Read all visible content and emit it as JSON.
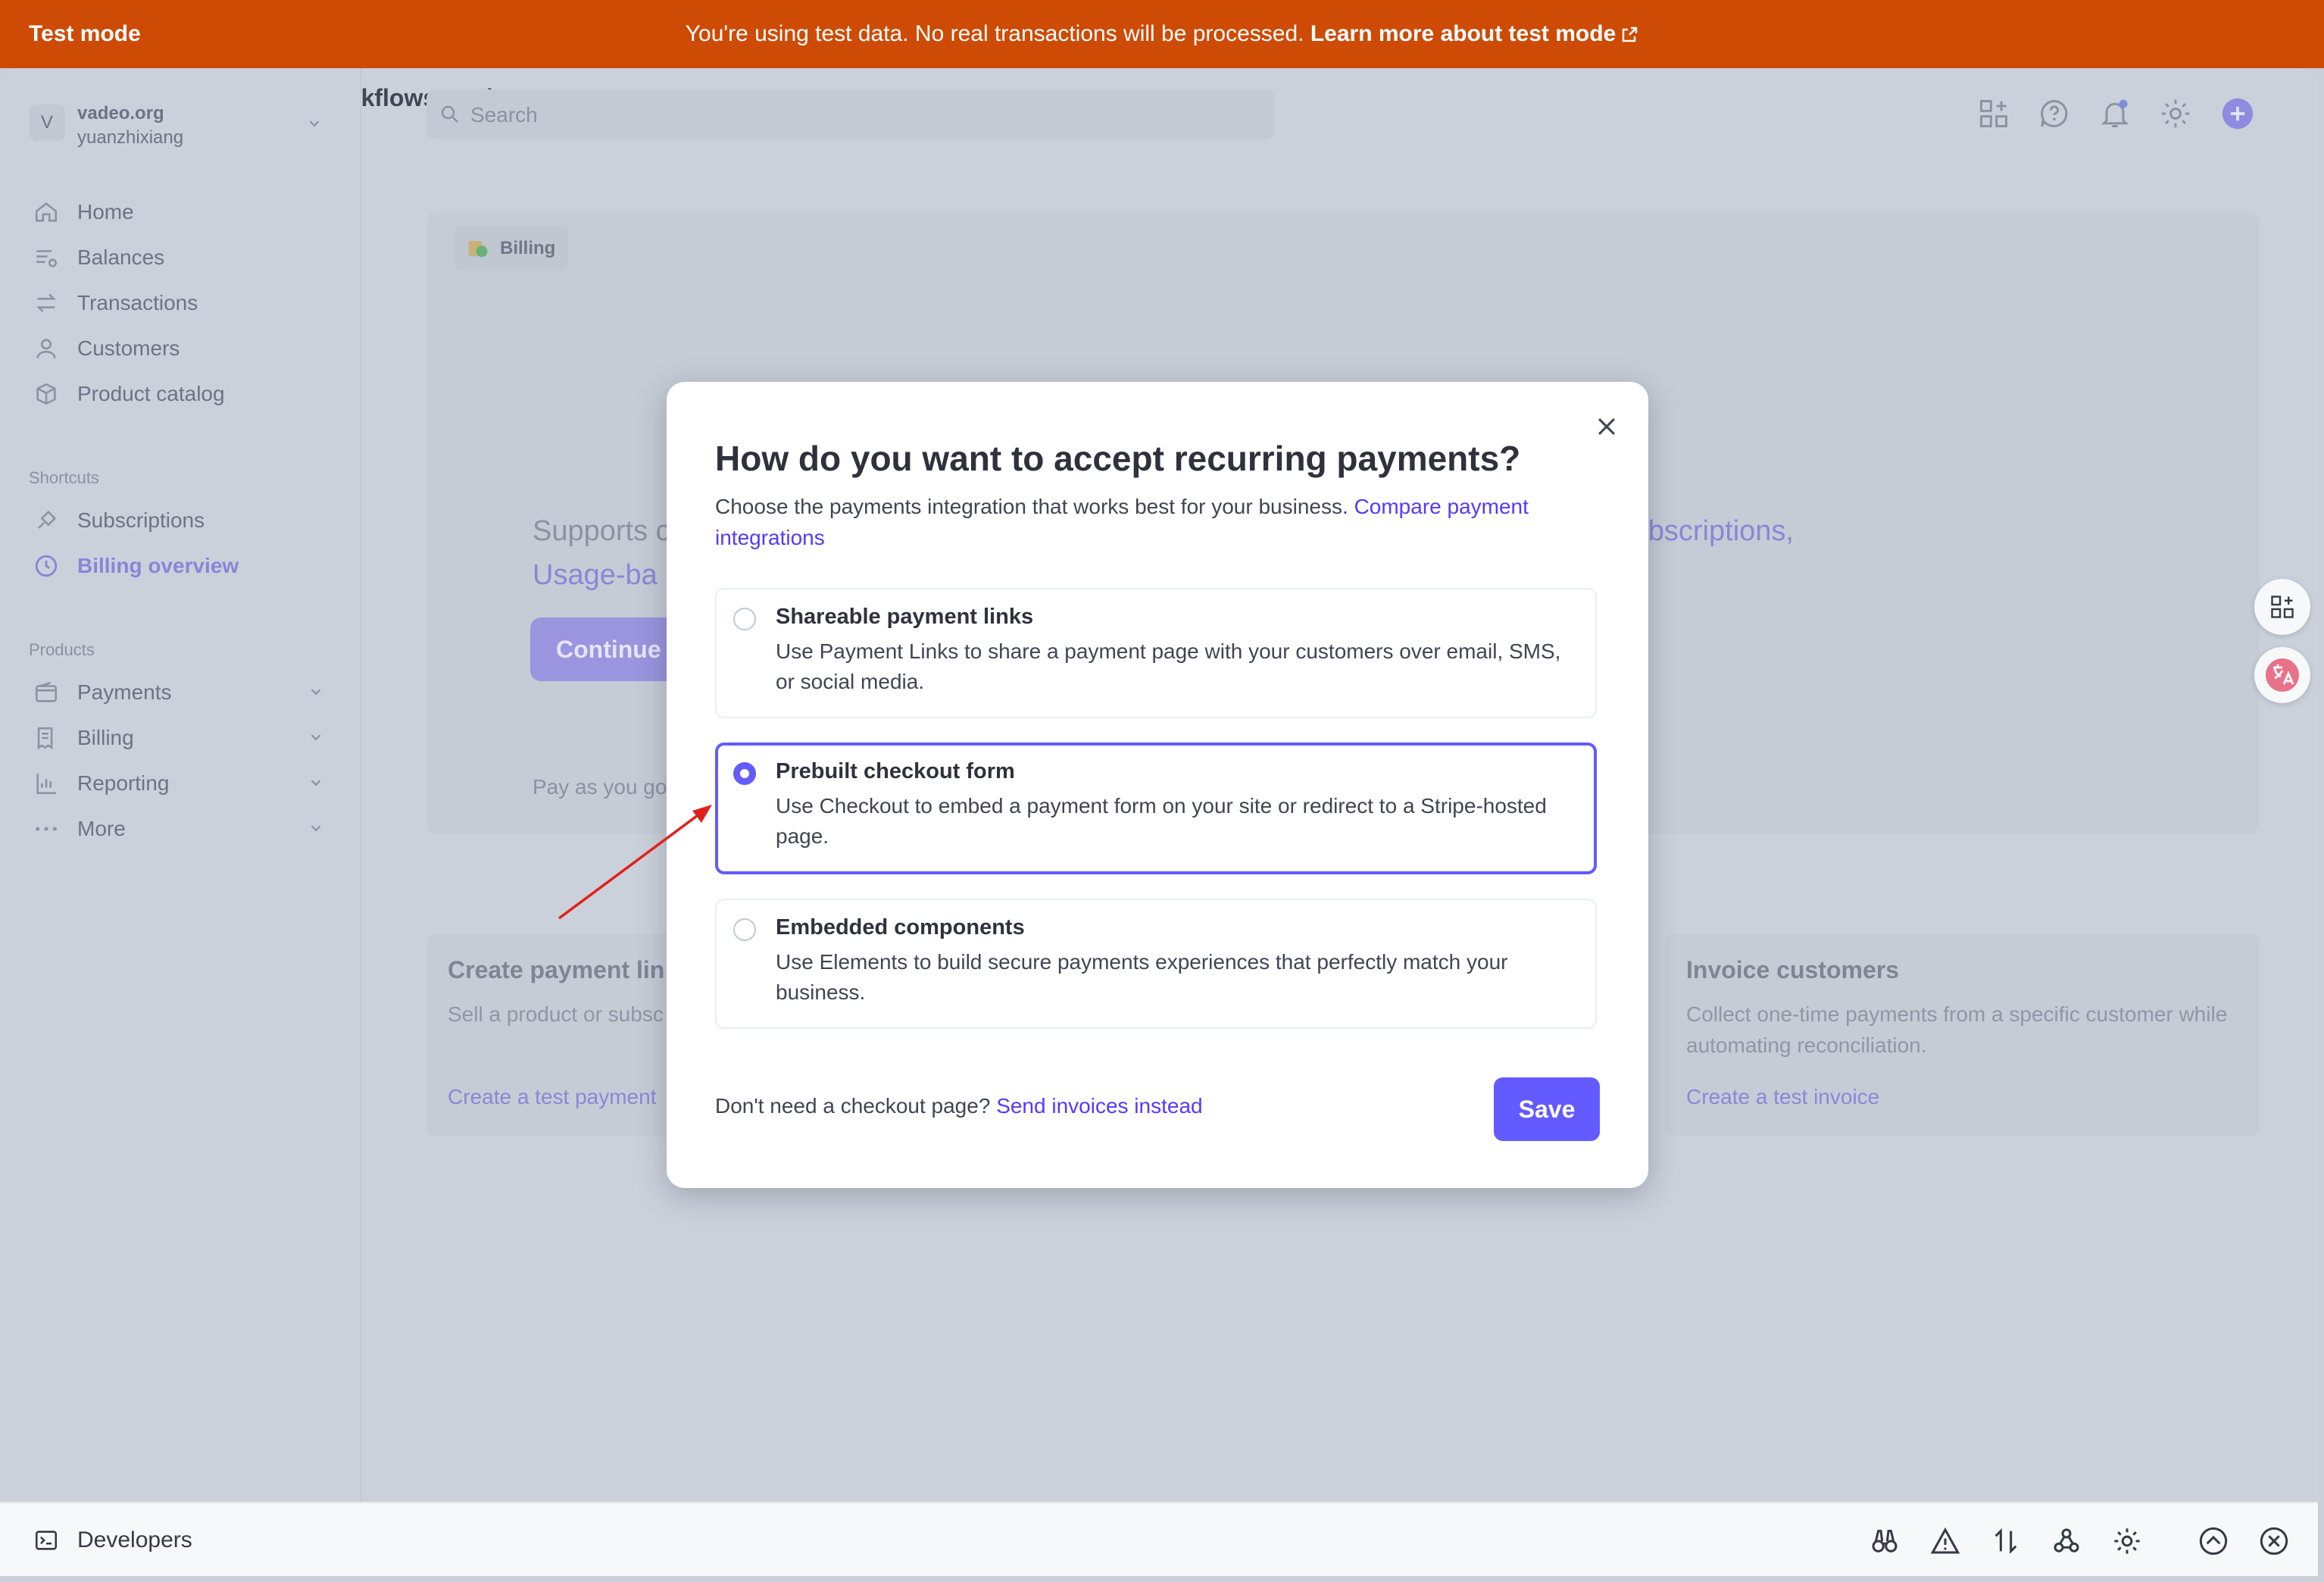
{
  "banner": {
    "mode_label": "Test mode",
    "message": "You're using test data. No real transactions will be processed.",
    "link": "Learn more about test mode"
  },
  "account": {
    "initial": "V",
    "name": "vadeo.org",
    "user": "yuanzhixiang"
  },
  "nav": {
    "main": [
      {
        "label": "Home",
        "icon": "home-icon"
      },
      {
        "label": "Balances",
        "icon": "balances-icon"
      },
      {
        "label": "Transactions",
        "icon": "transactions-icon"
      },
      {
        "label": "Customers",
        "icon": "customers-icon"
      },
      {
        "label": "Product catalog",
        "icon": "product-catalog-icon"
      }
    ],
    "shortcuts_label": "Shortcuts",
    "shortcuts": [
      {
        "label": "Subscriptions",
        "icon": "subscriptions-icon"
      },
      {
        "label": "Billing overview",
        "icon": "clock-icon",
        "active": true
      }
    ],
    "products_label": "Products",
    "products": [
      {
        "label": "Payments",
        "icon": "wallet-icon"
      },
      {
        "label": "Billing",
        "icon": "invoice-icon"
      },
      {
        "label": "Reporting",
        "icon": "chart-icon"
      },
      {
        "label": "More",
        "icon": "more-icon"
      }
    ]
  },
  "search": {
    "placeholder": "Search"
  },
  "hero": {
    "chip": "Billing",
    "title": "Manage revenue, automate workflows, and acce",
    "subtitle_start": "Supports c",
    "subtitle_link": "ubscriptions,",
    "subtitle_line2": "Usage-ba",
    "continue": "Continue",
    "pay_as": "Pay as you go"
  },
  "cards": [
    {
      "title": "Create payment lin",
      "desc": "Sell a product or subsc payment page.",
      "link": "Create a test payment"
    },
    {
      "title": "Invoice customers",
      "desc": "Collect one-time payments from a specific customer while automating reconciliation.",
      "link": "Create a test invoice"
    }
  ],
  "modal": {
    "title": "How do you want to accept recurring payments?",
    "intro": "Choose the payments integration that works best for your business.",
    "intro_link": "Compare payment integrations",
    "options": [
      {
        "title": "Shareable payment links",
        "desc": "Use Payment Links to share a payment page with your customers over email, SMS, or social media.",
        "selected": false
      },
      {
        "title": "Prebuilt checkout form",
        "desc": "Use Checkout to embed a payment form on your site or redirect to a Stripe-hosted page.",
        "selected": true
      },
      {
        "title": "Embedded components",
        "desc": "Use Elements to build secure payments experiences that perfectly match your business.",
        "selected": false
      }
    ],
    "footer_text": "Don't need a checkout page?",
    "footer_link": "Send invoices instead",
    "save": "Save"
  },
  "dev_bar": {
    "label": "Developers"
  },
  "colors": {
    "banner": "#cd4b05",
    "accent": "#635bff",
    "link": "#533afd"
  }
}
